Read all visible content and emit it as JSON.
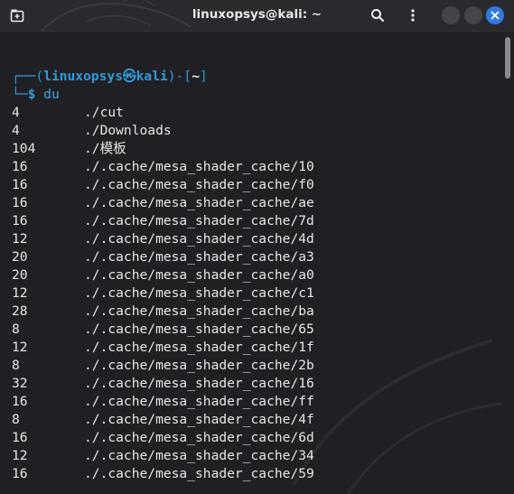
{
  "window": {
    "title": "linuxopsys@kali: ~"
  },
  "icons": {
    "new_tab": "new-tab-icon",
    "search": "search-icon",
    "menu": "kebab-menu-icon",
    "close": "close-icon"
  },
  "colors": {
    "accent": "#2f9bd8",
    "close_button": "#2f7ae5",
    "background": "#202024",
    "titlebar": "#2a2a2e",
    "text": "#e6e6e6"
  },
  "prompt": {
    "corner_top": "┌──",
    "open_paren": "(",
    "user": "linuxopsys",
    "skull": "㉿",
    "host": "kali",
    "close_paren": ")",
    "dash": "-",
    "open_bracket": "[",
    "cwd": "~",
    "close_bracket": "]",
    "corner_bottom": "└─",
    "dollar": "$",
    "command": "du"
  },
  "output": [
    {
      "size": "4",
      "path": "./cut"
    },
    {
      "size": "4",
      "path": "./Downloads"
    },
    {
      "size": "104",
      "path": "./模板"
    },
    {
      "size": "16",
      "path": "./.cache/mesa_shader_cache/10"
    },
    {
      "size": "16",
      "path": "./.cache/mesa_shader_cache/f0"
    },
    {
      "size": "16",
      "path": "./.cache/mesa_shader_cache/ae"
    },
    {
      "size": "16",
      "path": "./.cache/mesa_shader_cache/7d"
    },
    {
      "size": "12",
      "path": "./.cache/mesa_shader_cache/4d"
    },
    {
      "size": "20",
      "path": "./.cache/mesa_shader_cache/a3"
    },
    {
      "size": "20",
      "path": "./.cache/mesa_shader_cache/a0"
    },
    {
      "size": "12",
      "path": "./.cache/mesa_shader_cache/c1"
    },
    {
      "size": "28",
      "path": "./.cache/mesa_shader_cache/ba"
    },
    {
      "size": "8",
      "path": "./.cache/mesa_shader_cache/65"
    },
    {
      "size": "12",
      "path": "./.cache/mesa_shader_cache/1f"
    },
    {
      "size": "8",
      "path": "./.cache/mesa_shader_cache/2b"
    },
    {
      "size": "32",
      "path": "./.cache/mesa_shader_cache/16"
    },
    {
      "size": "16",
      "path": "./.cache/mesa_shader_cache/ff"
    },
    {
      "size": "8",
      "path": "./.cache/mesa_shader_cache/4f"
    },
    {
      "size": "16",
      "path": "./.cache/mesa_shader_cache/6d"
    },
    {
      "size": "12",
      "path": "./.cache/mesa_shader_cache/34"
    },
    {
      "size": "16",
      "path": "./.cache/mesa_shader_cache/59"
    }
  ]
}
